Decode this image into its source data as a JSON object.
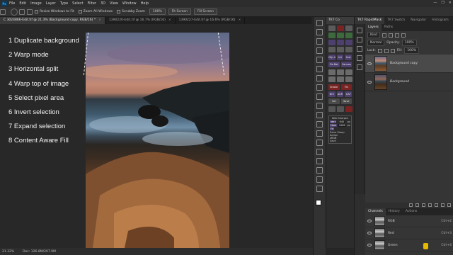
{
  "menubar": {
    "logo": "Ps",
    "items": [
      "File",
      "Edit",
      "Image",
      "Layer",
      "Type",
      "Select",
      "Filter",
      "3D",
      "View",
      "Window",
      "Help"
    ],
    "window_controls": [
      "—",
      "❐",
      "✕"
    ]
  },
  "options_bar": {
    "resize_windows": "Resize Windows to Fit",
    "zoom_all": "Zoom All Windows",
    "scrubby_zoom": "Scrubby Zoom",
    "zoom_value": "100%",
    "fit_screen": "Fit Screen",
    "fill_screen": "Fill Screen"
  },
  "tabs": [
    {
      "label": "C 3024866-Edit.tif @ 21.3% (Background copy, RGB/16) *",
      "active": true
    },
    {
      "label": "1390220-Edit.tif @ 16.7% (RGB/16)",
      "active": false
    },
    {
      "label": "1390227-Edit.tif @ 16.6% (RGB/16)",
      "active": false
    }
  ],
  "steps": [
    "1 Duplicate background",
    "2 Warp mode",
    "3 Horizontal split",
    "4 Warp top of image",
    "5 Select pixel area",
    "6 Invert selection",
    "7 Expand selection",
    "8 Content Aware Fill"
  ],
  "status": {
    "zoom": "21.32%",
    "doc": "Doc: 126.8M/207.9M"
  },
  "tk7": {
    "title": "TK7 Co",
    "labels_row1": [
      "Clip Int",
      "Int",
      "Inst"
    ],
    "labels_row2": [
      "Fla Bat",
      "Canvas"
    ],
    "labels_row3": [
      "Stroke",
      "Fill"
    ],
    "labels_row4": [
      "Dhr",
      "ACR",
      "CAF"
    ],
    "labels_row5": [
      "Sel",
      "Save"
    ],
    "web_sharpen": {
      "title": "Web Sharpen",
      "vert_label": "Vert",
      "vert_value": "840",
      "horz_label": "Horz",
      "horz_value": "1280",
      "unit": "px",
      "fit_label": "Fit",
      "extra_sharp": "Extra Sharp",
      "action": "Action",
      "sRGB": "sRGB",
      "save": "Save"
    }
  },
  "right_panel": {
    "top_tabs": [
      "TK7 RapidMask",
      "TK7 Switch",
      "Navigator",
      "Histogram"
    ],
    "layer_tabs": [
      "Layers",
      "Paths"
    ],
    "kind": "Kind",
    "blend_mode": "Normal",
    "opacity_label": "Opacity:",
    "opacity_value": "100%",
    "lock_label": "Lock:",
    "fill_label": "Fill:",
    "fill_value": "100%",
    "layers": [
      {
        "name": "Background copy",
        "italic": false,
        "selected": true
      },
      {
        "name": "Background",
        "italic": true,
        "selected": false
      }
    ],
    "channel_tabs": [
      "Channels",
      "History",
      "Actions"
    ],
    "channels": [
      {
        "name": "RGB",
        "shortcut": "Ctrl+2"
      },
      {
        "name": "Red",
        "shortcut": "Ctrl+3"
      },
      {
        "name": "Green",
        "shortcut": "Ctrl+4"
      }
    ]
  },
  "colors": {
    "foreground": "#ffffff",
    "background": "#000000",
    "accent": "#4d3f6e"
  }
}
